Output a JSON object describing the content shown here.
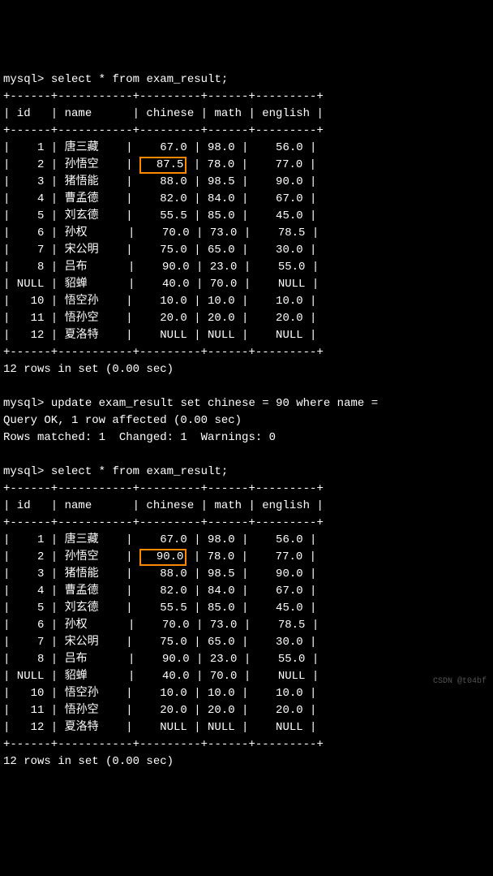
{
  "prompt": "mysql>",
  "queries": {
    "select1": "select * from exam_result;",
    "update": "update exam_result set chinese = 90 where name =",
    "select2": "select * from exam_result;"
  },
  "headers": {
    "id": "id",
    "name": "name",
    "chinese": "chinese",
    "math": "math",
    "english": "english"
  },
  "table1": {
    "rows": [
      {
        "id": "1",
        "name": "唐三藏",
        "chinese": "67.0",
        "math": "98.0",
        "english": "56.0"
      },
      {
        "id": "2",
        "name": "孙悟空",
        "chinese": "87.5",
        "math": "78.0",
        "english": "77.0"
      },
      {
        "id": "3",
        "name": "猪悟能",
        "chinese": "88.0",
        "math": "98.5",
        "english": "90.0"
      },
      {
        "id": "4",
        "name": "曹孟德",
        "chinese": "82.0",
        "math": "84.0",
        "english": "67.0"
      },
      {
        "id": "5",
        "name": "刘玄德",
        "chinese": "55.5",
        "math": "85.0",
        "english": "45.0"
      },
      {
        "id": "6",
        "name": "孙权",
        "chinese": "70.0",
        "math": "73.0",
        "english": "78.5"
      },
      {
        "id": "7",
        "name": "宋公明",
        "chinese": "75.0",
        "math": "65.0",
        "english": "30.0"
      },
      {
        "id": "8",
        "name": "吕布",
        "chinese": "90.0",
        "math": "23.0",
        "english": "55.0"
      },
      {
        "id": "NULL",
        "name": "貂蝉",
        "chinese": "40.0",
        "math": "70.0",
        "english": "NULL"
      },
      {
        "id": "10",
        "name": "悟空孙",
        "chinese": "10.0",
        "math": "10.0",
        "english": "10.0"
      },
      {
        "id": "11",
        "name": "悟孙空",
        "chinese": "20.0",
        "math": "20.0",
        "english": "20.0"
      },
      {
        "id": "12",
        "name": "夏洛特",
        "chinese": "NULL",
        "math": "NULL",
        "english": "NULL"
      }
    ],
    "highlight_row": 1,
    "highlight_col": "chinese"
  },
  "table2": {
    "rows": [
      {
        "id": "1",
        "name": "唐三藏",
        "chinese": "67.0",
        "math": "98.0",
        "english": "56.0"
      },
      {
        "id": "2",
        "name": "孙悟空",
        "chinese": "90.0",
        "math": "78.0",
        "english": "77.0"
      },
      {
        "id": "3",
        "name": "猪悟能",
        "chinese": "88.0",
        "math": "98.5",
        "english": "90.0"
      },
      {
        "id": "4",
        "name": "曹孟德",
        "chinese": "82.0",
        "math": "84.0",
        "english": "67.0"
      },
      {
        "id": "5",
        "name": "刘玄德",
        "chinese": "55.5",
        "math": "85.0",
        "english": "45.0"
      },
      {
        "id": "6",
        "name": "孙权",
        "chinese": "70.0",
        "math": "73.0",
        "english": "78.5"
      },
      {
        "id": "7",
        "name": "宋公明",
        "chinese": "75.0",
        "math": "65.0",
        "english": "30.0"
      },
      {
        "id": "8",
        "name": "吕布",
        "chinese": "90.0",
        "math": "23.0",
        "english": "55.0"
      },
      {
        "id": "NULL",
        "name": "貂蝉",
        "chinese": "40.0",
        "math": "70.0",
        "english": "NULL"
      },
      {
        "id": "10",
        "name": "悟空孙",
        "chinese": "10.0",
        "math": "10.0",
        "english": "10.0"
      },
      {
        "id": "11",
        "name": "悟孙空",
        "chinese": "20.0",
        "math": "20.0",
        "english": "20.0"
      },
      {
        "id": "12",
        "name": "夏洛特",
        "chinese": "NULL",
        "math": "NULL",
        "english": "NULL"
      }
    ],
    "highlight_row": 1,
    "highlight_col": "chinese"
  },
  "messages": {
    "rows_result": "12 rows in set (0.00 sec)",
    "query_ok": "Query OK, 1 row affected (0.00 sec)",
    "rows_matched": "Rows matched: 1  Changed: 1  Warnings: 0"
  },
  "border": "+------+-----------+---------+------+---------+",
  "watermark": "CSDN @t04bf"
}
